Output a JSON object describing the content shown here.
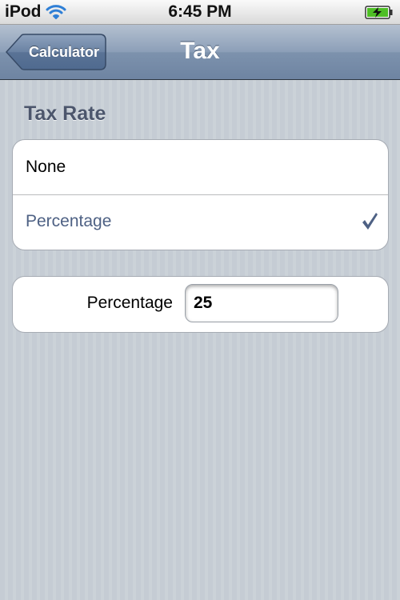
{
  "status_bar": {
    "carrier": "iPod",
    "time": "6:45 PM",
    "wifi_icon": "wifi-icon",
    "battery_icon": "battery-charging-icon"
  },
  "nav_bar": {
    "back_label": "Calculator",
    "title": "Tax"
  },
  "tax_rate": {
    "header": "Tax Rate",
    "options": [
      {
        "label": "None",
        "selected": false
      },
      {
        "label": "Percentage",
        "selected": true
      }
    ]
  },
  "percentage_field": {
    "label": "Percentage",
    "value": "25"
  },
  "colors": {
    "nav_bar": "#7d92ad",
    "selected_text": "#4e6184",
    "background": "#c5ccd4"
  }
}
